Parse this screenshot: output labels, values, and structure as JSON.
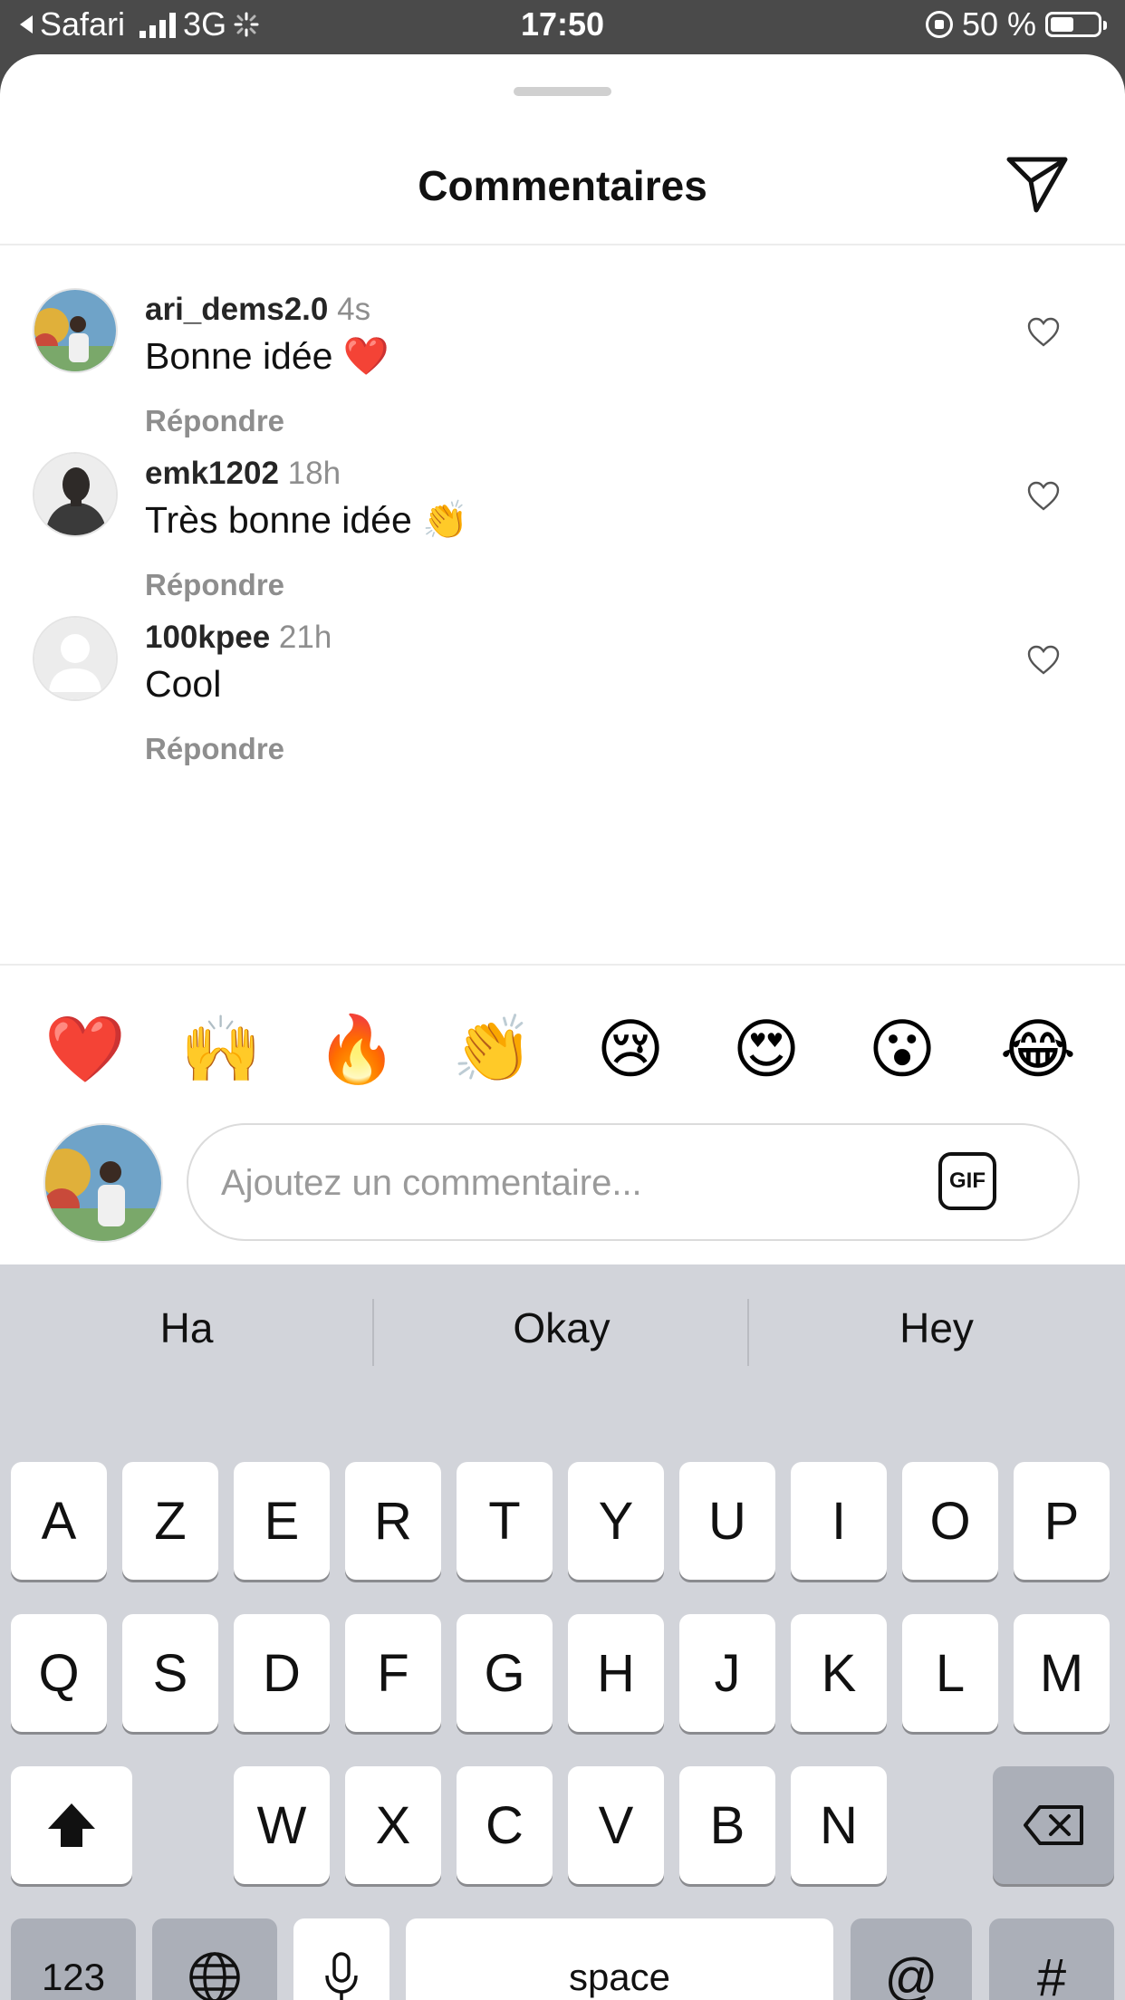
{
  "status": {
    "back_app": "Safari",
    "network": "3G",
    "time": "17:50",
    "battery": "50 %",
    "battery_level": 0.5
  },
  "sheet": {
    "title": "Commentaires"
  },
  "comments": [
    {
      "username": "ari_dems2.0",
      "time": "4s",
      "text": "Bonne idée ❤️",
      "reply": "Répondre"
    },
    {
      "username": "emk1202",
      "time": "18h",
      "text": "Très bonne idée 👏",
      "reply": "Répondre"
    },
    {
      "username": "100kpee",
      "time": "21h",
      "text": "Cool",
      "reply": "Répondre"
    }
  ],
  "reactions": [
    "❤️",
    "🙌",
    "🔥",
    "👏",
    "😢",
    "😍",
    "😮",
    "😂"
  ],
  "composer": {
    "placeholder": "Ajoutez un commentaire...",
    "gif_label": "GIF"
  },
  "keyboard": {
    "suggestions": [
      "Ha",
      "Okay",
      "Hey"
    ],
    "row1": [
      "A",
      "Z",
      "E",
      "R",
      "T",
      "Y",
      "U",
      "I",
      "O",
      "P"
    ],
    "row2": [
      "Q",
      "S",
      "D",
      "F",
      "G",
      "H",
      "J",
      "K",
      "L",
      "M"
    ],
    "row3": [
      "W",
      "X",
      "C",
      "V",
      "B",
      "N"
    ],
    "numbers_label": "123",
    "space_label": "space",
    "at_label": "@",
    "hash_label": "#"
  },
  "colors": {
    "status_bg": "#4a4a4a",
    "muted_text": "#8e8e8e",
    "keyboard_bg": "#d2d4da"
  },
  "icons": [
    "send-icon",
    "heart-outline-icon",
    "gif-icon",
    "shift-icon",
    "backspace-icon",
    "globe-icon",
    "microphone-icon"
  ]
}
